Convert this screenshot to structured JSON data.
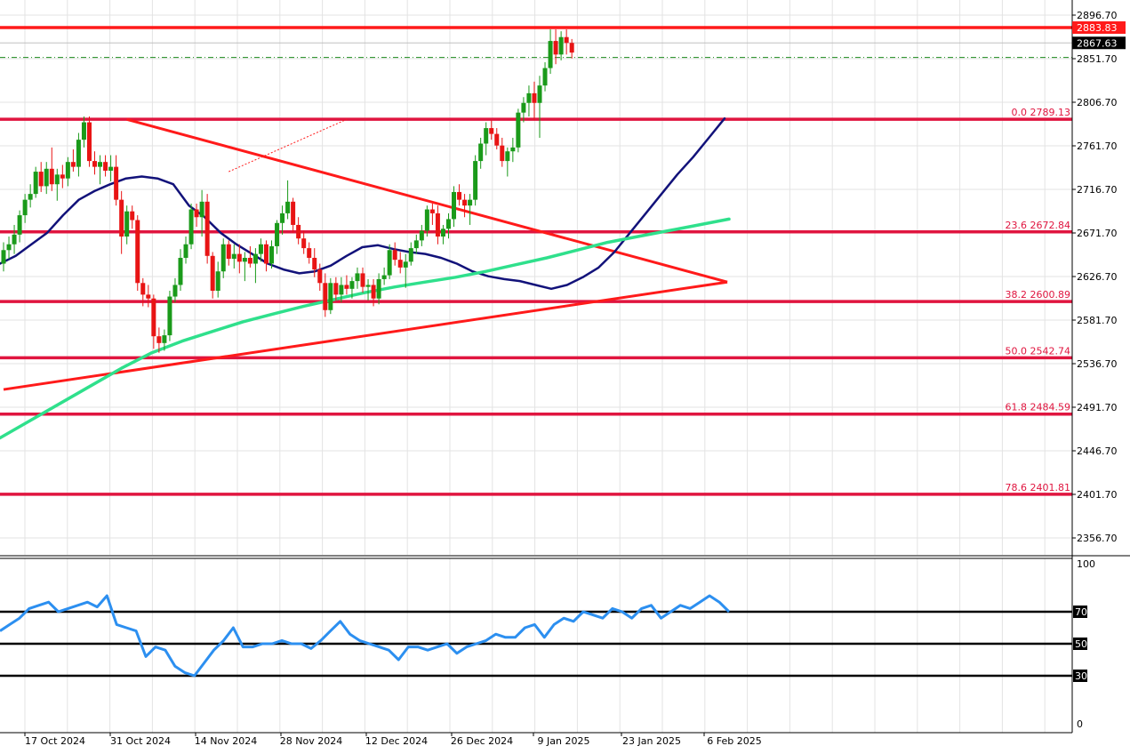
{
  "chart_data": [
    {
      "type": "candlestick",
      "panel": "price",
      "title": "",
      "y_ticks": [
        "2896.70",
        "2851.70",
        "2806.70",
        "2761.70",
        "2716.70",
        "2671.70",
        "2626.70",
        "2581.70",
        "2536.70",
        "2491.70",
        "2446.70",
        "2401.70",
        "2356.70"
      ],
      "ylim": [
        2318,
        2912
      ],
      "x_ticks": [
        "17 Oct 2024",
        "31 Oct 2024",
        "14 Nov 2024",
        "28 Nov 2024",
        "12 Dec 2024",
        "26 Dec 2024",
        "9 Jan 2025",
        "23 Jan 2025",
        "6 Feb 2025"
      ],
      "price_labels": {
        "resistance": "2883.83",
        "current": "2867.63"
      },
      "horizontal_levels": [
        2883.83,
        2789.13,
        2672.84,
        2600.89,
        2542.74,
        2484.59,
        2401.81
      ],
      "bid_line": 2853,
      "fib_labels": [
        {
          "text": "0.0 2789.13",
          "value": 2789.13
        },
        {
          "text": "23.6 2672.84",
          "value": 2672.84
        },
        {
          "text": "38.2 2600.89",
          "value": 2600.89
        },
        {
          "text": "50.0 2542.74",
          "value": 2542.74
        },
        {
          "text": "61.8 2484.59",
          "value": 2484.59
        },
        {
          "text": "78.6 2401.81",
          "value": 2401.81
        }
      ],
      "candles": [
        [
          2640,
          2662,
          2632,
          2654
        ],
        [
          2654,
          2668,
          2645,
          2660
        ],
        [
          2660,
          2680,
          2650,
          2670
        ],
        [
          2670,
          2695,
          2662,
          2690
        ],
        [
          2690,
          2712,
          2682,
          2706
        ],
        [
          2706,
          2722,
          2698,
          2712
        ],
        [
          2712,
          2740,
          2708,
          2735
        ],
        [
          2735,
          2745,
          2714,
          2720
        ],
        [
          2720,
          2745,
          2712,
          2738
        ],
        [
          2738,
          2760,
          2715,
          2722
        ],
        [
          2722,
          2738,
          2705,
          2732
        ],
        [
          2732,
          2742,
          2718,
          2728
        ],
        [
          2728,
          2750,
          2720,
          2745
        ],
        [
          2745,
          2758,
          2735,
          2740
        ],
        [
          2740,
          2775,
          2730,
          2768
        ],
        [
          2768,
          2792,
          2760,
          2786
        ],
        [
          2786,
          2792,
          2740,
          2746
        ],
        [
          2746,
          2756,
          2732,
          2740
        ],
        [
          2740,
          2752,
          2722,
          2745
        ],
        [
          2745,
          2752,
          2730,
          2736
        ],
        [
          2736,
          2752,
          2725,
          2740
        ],
        [
          2740,
          2752,
          2700,
          2706
        ],
        [
          2706,
          2715,
          2650,
          2668
        ],
        [
          2668,
          2700,
          2660,
          2694
        ],
        [
          2694,
          2700,
          2676,
          2685
        ],
        [
          2685,
          2690,
          2612,
          2620
        ],
        [
          2620,
          2625,
          2596,
          2608
        ],
        [
          2608,
          2618,
          2595,
          2604
        ],
        [
          2604,
          2608,
          2552,
          2565
        ],
        [
          2565,
          2574,
          2548,
          2558
        ],
        [
          2558,
          2572,
          2550,
          2566
        ],
        [
          2566,
          2612,
          2560,
          2606
        ],
        [
          2606,
          2625,
          2600,
          2618
        ],
        [
          2618,
          2655,
          2612,
          2646
        ],
        [
          2646,
          2668,
          2640,
          2660
        ],
        [
          2660,
          2702,
          2655,
          2696
        ],
        [
          2696,
          2702,
          2678,
          2688
        ],
        [
          2688,
          2716,
          2668,
          2704
        ],
        [
          2704,
          2712,
          2640,
          2648
        ],
        [
          2648,
          2652,
          2604,
          2612
        ],
        [
          2612,
          2642,
          2605,
          2632
        ],
        [
          2632,
          2666,
          2625,
          2660
        ],
        [
          2660,
          2664,
          2638,
          2645
        ],
        [
          2645,
          2660,
          2635,
          2650
        ],
        [
          2650,
          2660,
          2630,
          2642
        ],
        [
          2642,
          2652,
          2622,
          2646
        ],
        [
          2646,
          2658,
          2636,
          2640
        ],
        [
          2640,
          2656,
          2620,
          2650
        ],
        [
          2650,
          2666,
          2642,
          2660
        ],
        [
          2660,
          2664,
          2632,
          2640
        ],
        [
          2640,
          2664,
          2635,
          2658
        ],
        [
          2658,
          2685,
          2650,
          2682
        ],
        [
          2682,
          2700,
          2670,
          2692
        ],
        [
          2692,
          2726,
          2686,
          2704
        ],
        [
          2704,
          2708,
          2672,
          2680
        ],
        [
          2680,
          2688,
          2660,
          2666
        ],
        [
          2666,
          2674,
          2650,
          2656
        ],
        [
          2656,
          2662,
          2640,
          2646
        ],
        [
          2646,
          2656,
          2626,
          2634
        ],
        [
          2634,
          2640,
          2612,
          2620
        ],
        [
          2620,
          2630,
          2585,
          2592
        ],
        [
          2592,
          2625,
          2588,
          2620
        ],
        [
          2620,
          2626,
          2602,
          2608
        ],
        [
          2608,
          2626,
          2600,
          2618
        ],
        [
          2618,
          2628,
          2608,
          2614
        ],
        [
          2614,
          2626,
          2604,
          2622
        ],
        [
          2622,
          2636,
          2614,
          2630
        ],
        [
          2630,
          2636,
          2610,
          2616
        ],
        [
          2616,
          2624,
          2602,
          2618
        ],
        [
          2618,
          2624,
          2596,
          2604
        ],
        [
          2604,
          2630,
          2598,
          2624
        ],
        [
          2624,
          2636,
          2618,
          2628
        ],
        [
          2628,
          2660,
          2624,
          2654
        ],
        [
          2654,
          2662,
          2638,
          2644
        ],
        [
          2644,
          2652,
          2630,
          2636
        ],
        [
          2636,
          2650,
          2615,
          2642
        ],
        [
          2642,
          2662,
          2638,
          2656
        ],
        [
          2656,
          2670,
          2650,
          2664
        ],
        [
          2664,
          2680,
          2658,
          2674
        ],
        [
          2674,
          2700,
          2668,
          2696
        ],
        [
          2696,
          2702,
          2680,
          2692
        ],
        [
          2692,
          2700,
          2660,
          2668
        ],
        [
          2668,
          2680,
          2660,
          2676
        ],
        [
          2676,
          2692,
          2666,
          2686
        ],
        [
          2686,
          2720,
          2678,
          2714
        ],
        [
          2714,
          2722,
          2700,
          2706
        ],
        [
          2706,
          2712,
          2688,
          2700
        ],
        [
          2700,
          2712,
          2680,
          2706
        ],
        [
          2706,
          2752,
          2700,
          2746
        ],
        [
          2746,
          2770,
          2738,
          2764
        ],
        [
          2764,
          2786,
          2752,
          2780
        ],
        [
          2780,
          2788,
          2768,
          2774
        ],
        [
          2774,
          2780,
          2758,
          2762
        ],
        [
          2762,
          2770,
          2740,
          2746
        ],
        [
          2746,
          2760,
          2730,
          2756
        ],
        [
          2756,
          2770,
          2745,
          2760
        ],
        [
          2760,
          2800,
          2755,
          2796
        ],
        [
          2796,
          2812,
          2786,
          2806
        ],
        [
          2806,
          2824,
          2792,
          2816
        ],
        [
          2816,
          2828,
          2788,
          2806
        ],
        [
          2806,
          2834,
          2770,
          2824
        ],
        [
          2824,
          2848,
          2818,
          2842
        ],
        [
          2842,
          2882,
          2836,
          2870
        ],
        [
          2870,
          2882,
          2846,
          2856
        ],
        [
          2856,
          2880,
          2850,
          2874
        ],
        [
          2874,
          2882,
          2856,
          2868
        ],
        [
          2868,
          2872,
          2852,
          2858
        ]
      ],
      "series": [
        {
          "name": "",
          "color": "#12127a",
          "values": [
            2640,
            2648,
            2660,
            2672,
            2690,
            2706,
            2715,
            2722,
            2728,
            2730,
            2728,
            2722,
            2700,
            2688,
            2672,
            2660,
            2650,
            2640,
            2634,
            2630,
            2632,
            2638,
            2648,
            2657,
            2659,
            2655,
            2652,
            2650,
            2646,
            2640,
            2632,
            2627,
            2624,
            2622,
            2618,
            2614,
            2618,
            2626,
            2636,
            2652,
            2672,
            2692,
            2712,
            2732,
            2750,
            2770,
            2790
          ]
        },
        {
          "name": "",
          "color": "#2fe08c",
          "values": [
            2460,
            2478,
            2496,
            2514,
            2532,
            2548,
            2560,
            2570,
            2580,
            2588,
            2596,
            2603,
            2610,
            2616,
            2621,
            2626,
            2632,
            2639,
            2646,
            2654,
            2662,
            2668,
            2674,
            2680,
            2686
          ]
        }
      ],
      "trendlines": [
        {
          "from": [
            23,
            2789
          ],
          "to": [
            135,
            2621
          ]
        },
        {
          "from": [
            0,
            2510
          ],
          "to": [
            135,
            2621
          ]
        },
        {
          "from": [
            42,
            2735
          ],
          "to": [
            64,
            2789
          ],
          "style": "dotted"
        }
      ]
    },
    {
      "type": "line",
      "panel": "rsi",
      "y_ticks": [
        "100",
        "70",
        "50",
        "30",
        "0"
      ],
      "ylim": [
        0,
        100
      ],
      "levels": [
        70,
        50,
        30
      ],
      "level_labels": [
        "70",
        "50",
        "30"
      ],
      "series": [
        {
          "name": "",
          "color": "#2c8ff0",
          "values": [
            58,
            62,
            66,
            72,
            74,
            76,
            70,
            72,
            74,
            76,
            73,
            80,
            62,
            60,
            58,
            42,
            48,
            46,
            36,
            32,
            30,
            38,
            46,
            52,
            60,
            48,
            48,
            50,
            50,
            52,
            50,
            50,
            47,
            52,
            58,
            64,
            56,
            52,
            50,
            48,
            46,
            40,
            48,
            48,
            46,
            48,
            50,
            44,
            48,
            50,
            52,
            56,
            54,
            54,
            60,
            62,
            54,
            62,
            66,
            64,
            70,
            68,
            66,
            72,
            70,
            66,
            72,
            74,
            66,
            70,
            74,
            72,
            76,
            80,
            76,
            70
          ]
        }
      ]
    }
  ]
}
